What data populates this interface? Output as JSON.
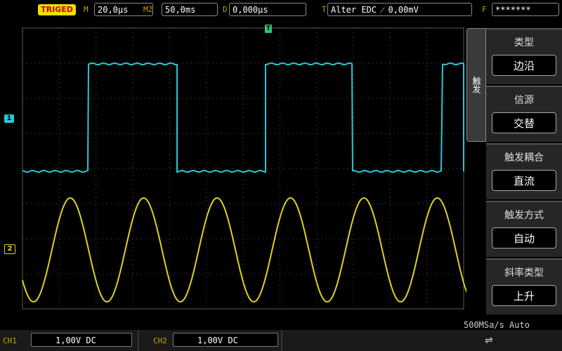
{
  "status": {
    "trigger_state": "TRIGED",
    "timebase_label": "M",
    "timebase_value": "20,0μs",
    "zoom_label": "M2",
    "zoom_value": "50,0ms",
    "delay_label": "D",
    "delay_value": "0,000μs",
    "trigger_label": "T",
    "trigger_value": "Alter EDC ⁄ 0,00mV",
    "freq_label": "F",
    "freq_value": "*******"
  },
  "scope": {
    "trigger_marker": "T",
    "ch1_marker": "1",
    "ch2_marker": "2",
    "colors": {
      "ch1": "#27c8d6",
      "ch2": "#e0d020",
      "grid": "#5a5a5a"
    }
  },
  "menu": {
    "tab_label": "触发",
    "items": [
      {
        "title": "类型",
        "value": "边沿"
      },
      {
        "title": "信源",
        "value": "交替"
      },
      {
        "title": "触发耦合",
        "value": "直流"
      },
      {
        "title": "触发方式",
        "value": "自动"
      },
      {
        "title": "斜率类型",
        "value": "上升"
      }
    ]
  },
  "sample_info": "500MSa/s Auto",
  "channels": {
    "ch1": {
      "label": "CH1",
      "value": "1,00V DC"
    },
    "ch2": {
      "label": "CH2",
      "value": "1,00V DC"
    }
  },
  "usb_icon": "usb-icon"
}
